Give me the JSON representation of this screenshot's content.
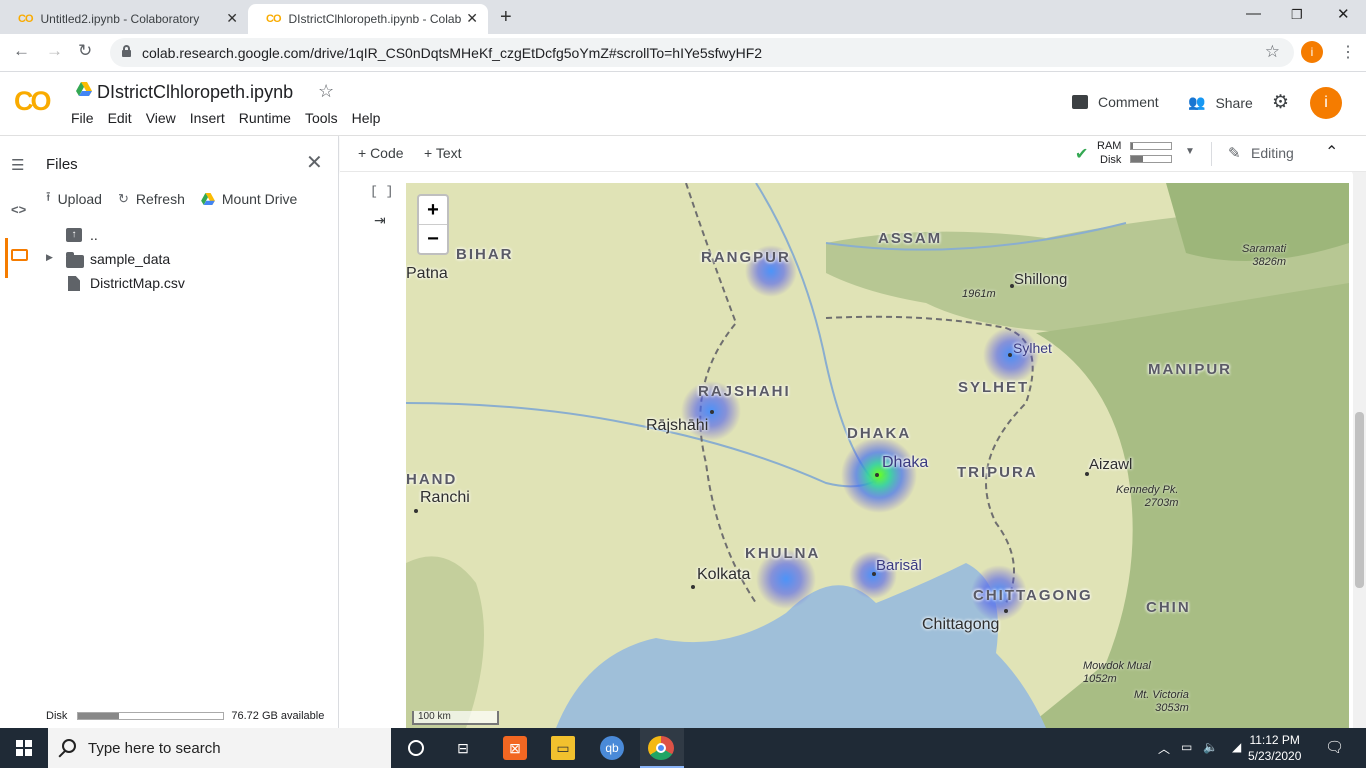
{
  "browser": {
    "tabs": [
      {
        "logo": "CO",
        "title": "Untitled2.ipynb - Colaboratory"
      },
      {
        "logo": "CO",
        "title": "DIstrictClhloropeth.ipynb - Colab"
      }
    ],
    "url": "colab.research.google.com/drive/1qIR_CS0nDqtsMHeKf_czgEtDcfg5oYmZ#scrollTo=hIYe5sfwyHF2",
    "profile_initial": "i"
  },
  "colab": {
    "logo": "CO",
    "notebook_title": "DIstrictClhloropeth.ipynb",
    "menu": [
      "File",
      "Edit",
      "View",
      "Insert",
      "Runtime",
      "Tools",
      "Help"
    ],
    "comment_label": "Comment",
    "share_label": "Share",
    "avatar_initial": "i",
    "add_code": "+ Code",
    "add_text": "+ Text",
    "ram_label": "RAM",
    "disk_label": "Disk",
    "ram_usage": 0.05,
    "disk_usage": 0.3,
    "editing_label": "Editing",
    "cell_brackets": "[ ]"
  },
  "files_panel": {
    "title": "Files",
    "upload_label": "Upload",
    "refresh_label": "Refresh",
    "mount_label": "Mount Drive",
    "items": [
      {
        "name": "..",
        "type": "parent"
      },
      {
        "name": "sample_data",
        "type": "folder"
      },
      {
        "name": "DistrictMap.csv",
        "type": "file"
      }
    ],
    "disk_label": "Disk",
    "disk_available": "76.72 GB available",
    "disk_usage": 0.28
  },
  "map": {
    "zoom_in": "+",
    "zoom_out": "−",
    "scale": "100 km",
    "regions": [
      "BIHAR",
      "RANGPUR",
      "ASSAM",
      "RAJSHAHI",
      "SYLHET",
      "MANIPUR",
      "DHAKA",
      "TRIPURA",
      "HAND",
      "KHULNA",
      "CHITTAGONG",
      "CHIN"
    ],
    "cities": [
      "Patna",
      "Shillong",
      "Sylhet",
      "Rājshāhi",
      "Dhaka",
      "Aizawl",
      "Ranchi",
      "Barisāl",
      "Kolkata",
      "Chittagong"
    ],
    "peaks": [
      {
        "name": "Saramati",
        "height": "3826m"
      },
      {
        "name": "",
        "height": "1961m"
      },
      {
        "name": "Kennedy Pk.",
        "height": "2703m"
      },
      {
        "name": "Mowdok Mual",
        "height": "1052m"
      },
      {
        "name": "Mt. Victoria",
        "height": "3053m"
      }
    ]
  },
  "taskbar": {
    "search_placeholder": "Type here to search",
    "time": "11:12 PM",
    "date": "5/23/2020"
  }
}
